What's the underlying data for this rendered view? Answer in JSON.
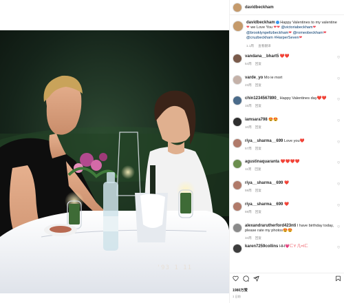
{
  "post": {
    "username": "davidbeckham",
    "caption_text": "Happy Valentines to my valentine",
    "caption_text_2": "we Love You",
    "caption_mentions": [
      "@victoriabeckham",
      "@brooklynpeltzbeckham",
      "@romeobeckham",
      "@cruzbeckham"
    ],
    "caption_hashtag": "#HarperSeven",
    "caption_meta": "1.1周",
    "caption_meta_reply": "查看翻译",
    "likes": "1980万赞",
    "date": "1 日前"
  },
  "photo": {
    "corner_stamp": "'93  1 11"
  },
  "comments": [
    {
      "user": "vandana__bhart5",
      "text": "",
      "emoji": "❤️❤️",
      "age": "54周",
      "reply": "回复"
    },
    {
      "user": "varde_yo",
      "text": "Mo ie mort",
      "emoji": "",
      "age": "23周",
      "reply": "回复"
    },
    {
      "user": "chin1234567890_",
      "text": "Happy Valentines day",
      "emoji": "❤️❤️",
      "age": "15周",
      "reply": "回复"
    },
    {
      "user": "iamsara798",
      "text": "",
      "emoji": "😍😍",
      "age": "10周",
      "reply": "回复"
    },
    {
      "user": "riya__sharma__699",
      "text": "Love you",
      "emoji": "❤️",
      "age": "57周",
      "reply": "回复"
    },
    {
      "user": "agustinaquaranta",
      "text": "",
      "emoji": "❤️❤️❤️❤️",
      "age": "11周",
      "reply": "回复"
    },
    {
      "user": "riya__sharma__699",
      "text": "",
      "emoji": "❤️",
      "age": "59周",
      "reply": "回复"
    },
    {
      "user": "riya__sharma__699",
      "text": "",
      "emoji": "❤️",
      "age": "59周",
      "reply": "回复"
    },
    {
      "user": "alexandrarutherford423nti",
      "text": "I have birthday today, please rate my photos",
      "emoji": "😍😍",
      "age": "34周",
      "reply": "回复"
    },
    {
      "user": "karen7259collins",
      "text": "HH",
      "emoji": "💗ㄈY 几=Iㄈ",
      "age": "",
      "reply": ""
    }
  ],
  "icons": {
    "like": "heart-outline-icon",
    "comment": "comment-icon",
    "share": "paper-plane-icon",
    "save": "bookmark-icon"
  },
  "colors": {
    "accent_like": "#ed4956",
    "verified": "#3897f0",
    "link": "#00376b",
    "muted": "#8e8e8e"
  }
}
